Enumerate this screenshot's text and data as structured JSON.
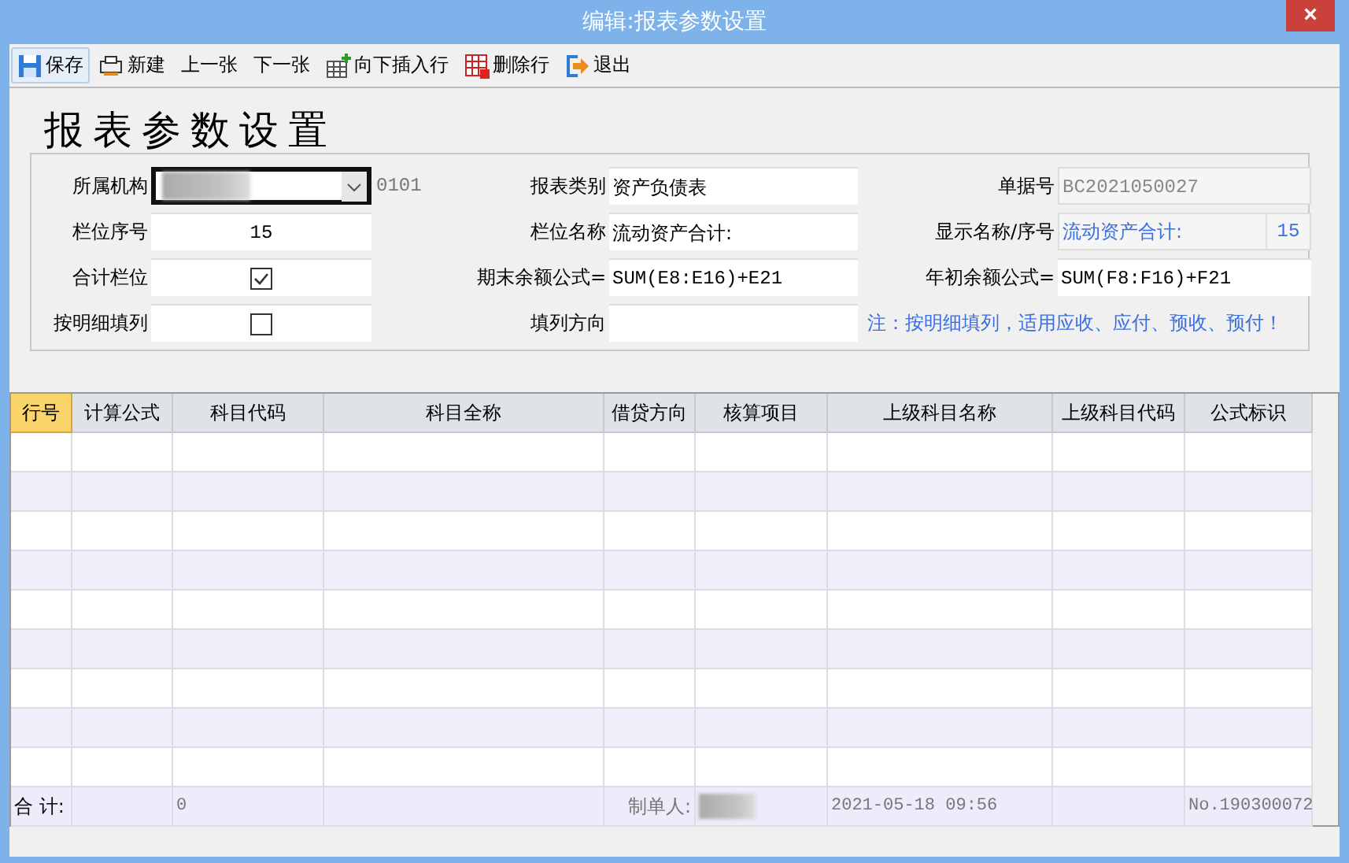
{
  "window": {
    "title": "编辑:报表参数设置",
    "close": "×"
  },
  "toolbar": [
    {
      "label": "保存",
      "kind": "save",
      "selected": true
    },
    {
      "label": "新建",
      "kind": "new",
      "selected": false
    },
    {
      "label": "上一张",
      "kind": "plain",
      "selected": false
    },
    {
      "label": "下一张",
      "kind": "plain",
      "selected": false
    },
    {
      "label": "向下插入行",
      "kind": "insert",
      "selected": false
    },
    {
      "label": "删除行",
      "kind": "delete",
      "selected": false
    },
    {
      "label": "退出",
      "kind": "exit",
      "selected": false
    }
  ],
  "heading": "报表参数设置",
  "form": [
    {
      "label": "所属机构",
      "kind": "select",
      "suffix": "0101"
    },
    {
      "label": "报表类别",
      "kind": "text",
      "value": "资产负债表"
    },
    {
      "label": "单据号",
      "kind": "readonly",
      "value": "BC2021050027"
    },
    {
      "label": "栏位序号",
      "kind": "number",
      "value": "15"
    },
    {
      "label": "栏位名称",
      "kind": "text",
      "value": "流动资产合计:"
    },
    {
      "label": "显示名称/序号",
      "kind": "pair",
      "value": "流动资产合计:",
      "number": "15"
    },
    {
      "label": "合计栏位",
      "kind": "checkbox",
      "checked": true
    },
    {
      "label": "期末余额公式=",
      "kind": "mono",
      "value": "SUM(E8:E16)+E21"
    },
    {
      "label": "年初余额公式=",
      "kind": "mono",
      "value": "SUM(F8:F16)+F21"
    },
    {
      "label": "按明细填列",
      "kind": "checkbox",
      "checked": false
    },
    {
      "label": "填列方向",
      "kind": "empty"
    },
    {
      "kind": "note",
      "value": "注：按明细填列，适用应收、应付、预收、预付！"
    }
  ],
  "table": {
    "columns": [
      {
        "label": "行号",
        "selected": true
      },
      {
        "label": "计算公式",
        "selected": false
      },
      {
        "label": "科目代码",
        "selected": false
      },
      {
        "label": "科目全称",
        "selected": false
      },
      {
        "label": "借贷方向",
        "selected": false
      },
      {
        "label": "核算项目",
        "selected": false
      },
      {
        "label": "上级科目名称",
        "selected": false
      },
      {
        "label": "上级科目代码",
        "selected": false
      },
      {
        "label": "公式标识",
        "selected": false
      }
    ],
    "footer": [
      {
        "kind": "text",
        "text": "合 计:"
      },
      {
        "kind": "blank"
      },
      {
        "kind": "value",
        "text": "0"
      },
      {
        "kind": "blank"
      },
      {
        "kind": "caption",
        "text": "制单人:"
      },
      {
        "kind": "redacted"
      },
      {
        "kind": "value",
        "text": "2021-05-18 09:56"
      },
      {
        "kind": "blank"
      },
      {
        "kind": "value",
        "text": "No.190300072"
      }
    ]
  }
}
